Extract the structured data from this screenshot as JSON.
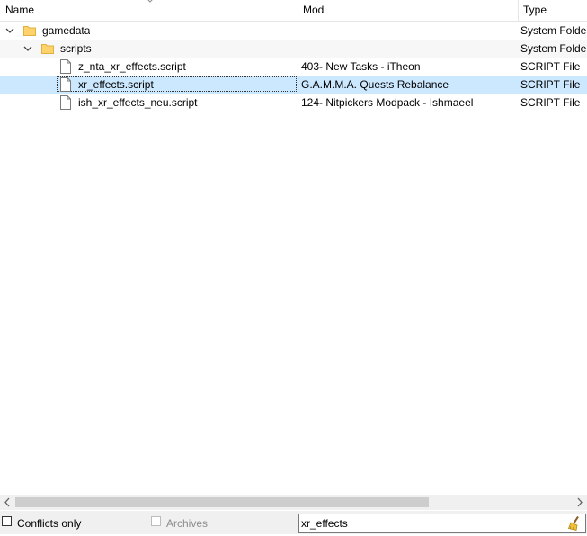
{
  "columns": {
    "name": "Name",
    "mod": "Mod",
    "type": "Type"
  },
  "rows": [
    {
      "name": "gamedata",
      "mod": "",
      "type": "System Folder",
      "kind": "folder",
      "expanded": true,
      "level": 0
    },
    {
      "name": "scripts",
      "mod": "",
      "type": "System Folder",
      "kind": "folder",
      "expanded": true,
      "level": 1
    },
    {
      "name": "z_nta_xr_effects.script",
      "mod": "403- New Tasks - iTheon",
      "type": "SCRIPT File",
      "kind": "file",
      "level": 2
    },
    {
      "name": "xr_effects.script",
      "mod": "G.A.M.M.A. Quests Rebalance",
      "type": "SCRIPT File",
      "kind": "file",
      "level": 2,
      "selected": true
    },
    {
      "name": "ish_xr_effects_neu.script",
      "mod": "124- Nitpickers Modpack - Ishmaeel",
      "type": "SCRIPT File",
      "kind": "file",
      "level": 2
    }
  ],
  "bottom": {
    "conflicts_only": {
      "label": "Conflicts only",
      "checked": false
    },
    "archives": {
      "label": "Archives",
      "checked": false,
      "enabled": false
    },
    "filter": {
      "value": "xr_effects"
    }
  },
  "icons": {
    "sort": "chevron-up-icon",
    "expand": "chevron-down-icon",
    "folder": "folder-icon",
    "file": "file-icon",
    "clear": "broom-icon",
    "scroll_left": "arrow-left-icon",
    "scroll_right": "arrow-right-icon"
  },
  "colors": {
    "selection": "#cce8ff",
    "folder": "#ffd36b",
    "header_border": "#e5e5e5",
    "panel": "#f0f0f0"
  }
}
